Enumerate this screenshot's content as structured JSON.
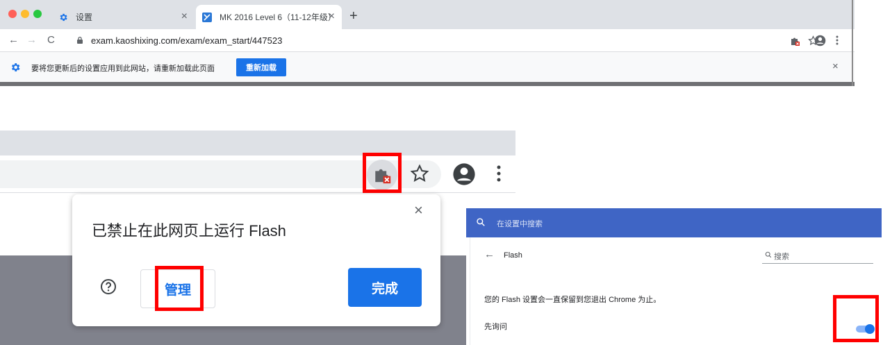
{
  "browser": {
    "tabs": [
      {
        "label": "设置"
      },
      {
        "label": "MK 2016 Level 6（11-12年级）"
      }
    ],
    "new_tab": "+",
    "tab_close": "×",
    "nav": {
      "back": "←",
      "forward": "→",
      "reload": "C"
    },
    "url": "exam.kaoshixing.com/exam/exam_start/447523",
    "menu_glyph": "⋮"
  },
  "infobar": {
    "message": "要将您更新后的设置应用到此网站，请重新加载此页面",
    "button_label": "重新加载",
    "close": "×"
  },
  "flash_popup": {
    "title": "已禁止在此网页上运行 Flash",
    "close": "×",
    "manage_label": "管理",
    "done_label": "完成",
    "highlight_color": "#ff0000"
  },
  "settings": {
    "search_placeholder": "在设置中搜索",
    "back": "←",
    "page_title": "Flash",
    "subpage_search_placeholder": "搜索",
    "description": "您的 Flash 设置会一直保留到您退出 Chrome 为止。",
    "ask_first_label": "先询问",
    "ask_first_enabled": true,
    "header_color": "#3f65c5"
  },
  "colors": {
    "accent": "#1a73e8",
    "highlight": "#ff0000",
    "tabstrip": "#dee1e6"
  },
  "icons": {
    "settings_tab": "gear-icon",
    "kaoshixing_tab": "kaoshixing-logo-icon",
    "flash_blocked": "plugin-blocked-icon",
    "bookmark": "star-icon",
    "profile": "avatar-icon",
    "menu": "kebab-menu-icon",
    "help": "help-circle-icon",
    "search": "search-icon",
    "lock": "lock-icon"
  }
}
